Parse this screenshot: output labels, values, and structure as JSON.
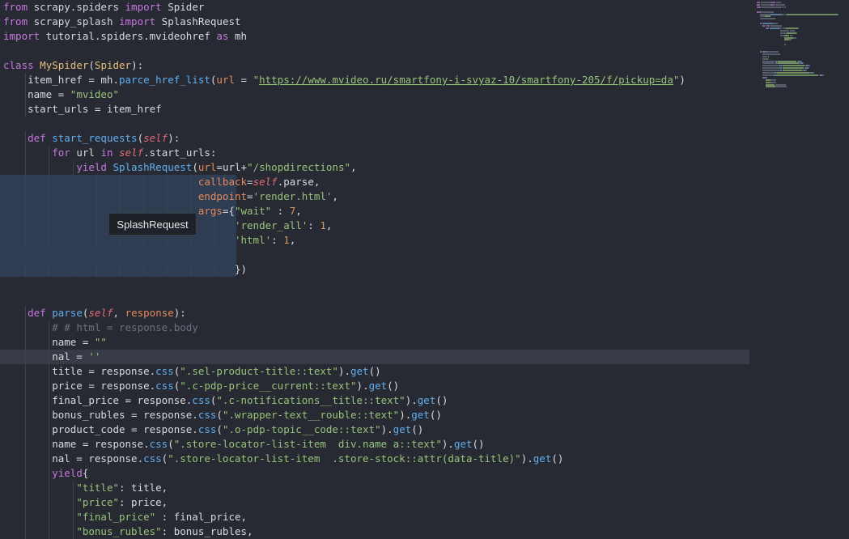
{
  "editor": {
    "language": "python",
    "lines": [
      [
        [
          "kw",
          "from"
        ],
        [
          "plain",
          " scrapy.spiders "
        ],
        [
          "kw",
          "import"
        ],
        [
          "plain",
          " Spider"
        ]
      ],
      [
        [
          "kw",
          "from"
        ],
        [
          "plain",
          " scrapy_splash "
        ],
        [
          "kw",
          "import"
        ],
        [
          "plain",
          " SplashRequest"
        ]
      ],
      [
        [
          "kw",
          "import"
        ],
        [
          "plain",
          " tutorial.spiders.mvideohref "
        ],
        [
          "kw",
          "as"
        ],
        [
          "plain",
          " mh"
        ]
      ],
      [],
      [
        [
          "kw",
          "class"
        ],
        [
          "plain",
          " "
        ],
        [
          "cls",
          "MySpider"
        ],
        [
          "plain",
          "("
        ],
        [
          "cls",
          "Spider"
        ],
        [
          "plain",
          "):"
        ]
      ],
      [
        [
          "plain",
          "    item_href = mh."
        ],
        [
          "fn",
          "parce_href_list"
        ],
        [
          "plain",
          "("
        ],
        [
          "param",
          "url"
        ],
        [
          "plain",
          " = "
        ],
        [
          "str",
          "\""
        ],
        [
          "url",
          "https://www.mvideo.ru/smartfony-i-svyaz-10/smartfony-205/f/pickup=da"
        ],
        [
          "str",
          "\""
        ],
        [
          "plain",
          ")"
        ]
      ],
      [
        [
          "plain",
          "    name = "
        ],
        [
          "str",
          "\"mvideo\""
        ]
      ],
      [
        [
          "plain",
          "    start_urls = item_href"
        ]
      ],
      [],
      [
        [
          "plain",
          "    "
        ],
        [
          "kw",
          "def"
        ],
        [
          "plain",
          " "
        ],
        [
          "fn",
          "start_requests"
        ],
        [
          "plain",
          "("
        ],
        [
          "self",
          "self"
        ],
        [
          "plain",
          "):"
        ]
      ],
      [
        [
          "plain",
          "        "
        ],
        [
          "kw",
          "for"
        ],
        [
          "plain",
          " url "
        ],
        [
          "kw",
          "in"
        ],
        [
          "plain",
          " "
        ],
        [
          "self",
          "self"
        ],
        [
          "plain",
          ".start_urls:"
        ]
      ],
      [
        [
          "plain",
          "            "
        ],
        [
          "kw",
          "yield"
        ],
        [
          "plain",
          " "
        ],
        [
          "fn",
          "SplashRequest"
        ],
        [
          "plain",
          "("
        ],
        [
          "param",
          "url"
        ],
        [
          "plain",
          "=url+"
        ],
        [
          "str",
          "\"/shopdirections\""
        ],
        [
          "plain",
          ","
        ]
      ],
      [
        [
          "plain",
          "                                "
        ],
        [
          "param",
          "callback"
        ],
        [
          "plain",
          "="
        ],
        [
          "self",
          "self"
        ],
        [
          "plain",
          ".parse,"
        ]
      ],
      [
        [
          "plain",
          "                                "
        ],
        [
          "param",
          "endpoint"
        ],
        [
          "plain",
          "="
        ],
        [
          "str",
          "'render.html'"
        ],
        [
          "plain",
          ","
        ]
      ],
      [
        [
          "plain",
          "                                "
        ],
        [
          "param",
          "args"
        ],
        [
          "plain",
          "={"
        ],
        [
          "str",
          "\"wait\""
        ],
        [
          "plain",
          " : "
        ],
        [
          "num",
          "7"
        ],
        [
          "plain",
          ","
        ]
      ],
      [
        [
          "plain",
          "                                      "
        ],
        [
          "str",
          "'render_all'"
        ],
        [
          "plain",
          ": "
        ],
        [
          "num",
          "1"
        ],
        [
          "plain",
          ","
        ]
      ],
      [
        [
          "plain",
          "                                      "
        ],
        [
          "str",
          "'html'"
        ],
        [
          "plain",
          ": "
        ],
        [
          "num",
          "1"
        ],
        [
          "plain",
          ","
        ]
      ],
      [],
      [
        [
          "plain",
          "                                      })"
        ]
      ],
      [],
      [],
      [
        [
          "plain",
          "    "
        ],
        [
          "kw",
          "def"
        ],
        [
          "plain",
          " "
        ],
        [
          "fn",
          "parse"
        ],
        [
          "plain",
          "("
        ],
        [
          "self",
          "self"
        ],
        [
          "plain",
          ", "
        ],
        [
          "param",
          "response"
        ],
        [
          "plain",
          "):"
        ]
      ],
      [
        [
          "plain",
          "        "
        ],
        [
          "com",
          "# # html = response.body"
        ]
      ],
      [
        [
          "plain",
          "        name = "
        ],
        [
          "str",
          "\"\""
        ]
      ],
      [
        [
          "plain",
          "        nal = "
        ],
        [
          "str",
          "''"
        ]
      ],
      [
        [
          "plain",
          "        title = response."
        ],
        [
          "fn",
          "css"
        ],
        [
          "plain",
          "("
        ],
        [
          "str",
          "\".sel-product-title::text\""
        ],
        [
          "plain",
          ")."
        ],
        [
          "fn",
          "get"
        ],
        [
          "plain",
          "()"
        ]
      ],
      [
        [
          "plain",
          "        price = response."
        ],
        [
          "fn",
          "css"
        ],
        [
          "plain",
          "("
        ],
        [
          "str",
          "\".c-pdp-price__current::text\""
        ],
        [
          "plain",
          ")."
        ],
        [
          "fn",
          "get"
        ],
        [
          "plain",
          "()"
        ]
      ],
      [
        [
          "plain",
          "        final_price = response."
        ],
        [
          "fn",
          "css"
        ],
        [
          "plain",
          "("
        ],
        [
          "str",
          "\".c-notifications__title::text\""
        ],
        [
          "plain",
          ")."
        ],
        [
          "fn",
          "get"
        ],
        [
          "plain",
          "()"
        ]
      ],
      [
        [
          "plain",
          "        bonus_rubles = response."
        ],
        [
          "fn",
          "css"
        ],
        [
          "plain",
          "("
        ],
        [
          "str",
          "\".wrapper-text__rouble::text\""
        ],
        [
          "plain",
          ")."
        ],
        [
          "fn",
          "get"
        ],
        [
          "plain",
          "()"
        ]
      ],
      [
        [
          "plain",
          "        product_code = response."
        ],
        [
          "fn",
          "css"
        ],
        [
          "plain",
          "("
        ],
        [
          "str",
          "\".o-pdp-topic__code::text\""
        ],
        [
          "plain",
          ")."
        ],
        [
          "fn",
          "get"
        ],
        [
          "plain",
          "()"
        ]
      ],
      [
        [
          "plain",
          "        name = response."
        ],
        [
          "fn",
          "css"
        ],
        [
          "plain",
          "("
        ],
        [
          "str",
          "\".store-locator-list-item  div.name a::text\""
        ],
        [
          "plain",
          ")."
        ],
        [
          "fn",
          "get"
        ],
        [
          "plain",
          "()"
        ]
      ],
      [
        [
          "plain",
          "        nal = response."
        ],
        [
          "fn",
          "css"
        ],
        [
          "plain",
          "("
        ],
        [
          "str",
          "\".store-locator-list-item  .store-stock::attr(data-title)\""
        ],
        [
          "plain",
          ")."
        ],
        [
          "fn",
          "get"
        ],
        [
          "plain",
          "()"
        ]
      ],
      [
        [
          "plain",
          "        "
        ],
        [
          "kw",
          "yield"
        ],
        [
          "plain",
          "{"
        ]
      ],
      [
        [
          "plain",
          "            "
        ],
        [
          "str",
          "\"title\""
        ],
        [
          "plain",
          ": title,"
        ]
      ],
      [
        [
          "plain",
          "            "
        ],
        [
          "str",
          "\"price\""
        ],
        [
          "plain",
          ": price,"
        ]
      ],
      [
        [
          "plain",
          "            "
        ],
        [
          "str",
          "\"final_price\""
        ],
        [
          "plain",
          " : final_price,"
        ]
      ],
      [
        [
          "plain",
          "            "
        ],
        [
          "str",
          "\"bonus_rubles\""
        ],
        [
          "plain",
          ": bonus_rubles,"
        ]
      ]
    ]
  },
  "tooltip": {
    "text": "SplashRequest"
  },
  "colors": {
    "background": "#272a33",
    "selection": "#2f3d52",
    "current_line": "#363b46"
  }
}
